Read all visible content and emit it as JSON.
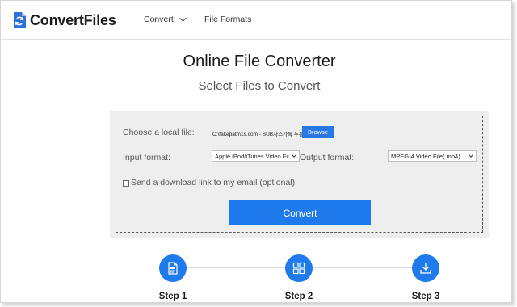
{
  "header": {
    "logo_text": "ConvertFiles",
    "nav": [
      {
        "label": "Convert",
        "has_dropdown": true
      },
      {
        "label": "File Formats",
        "has_dropdown": false
      }
    ]
  },
  "main": {
    "title": "Online File Converter",
    "subtitle": "Select Files to Convert"
  },
  "form": {
    "local_file_label": "Choose a local file:",
    "file_value": "C:\\fakepath\\1s.com - SUB자즈가톡 두통",
    "browse_label": "Browse",
    "input_format_label": "Input format:",
    "input_format_value": "Apple iPod/iTunes Video Fil",
    "output_format_label": "Output format:",
    "output_format_value": "MPEG-4 Video File(.mp4)",
    "email_checkbox_label": "Send a download link to my email (optional):",
    "email_checked": false,
    "convert_label": "Convert"
  },
  "steps": [
    {
      "label": "Step 1",
      "icon": "document-upload-icon"
    },
    {
      "label": "Step 2",
      "icon": "grid-icon"
    },
    {
      "label": "Step 3",
      "icon": "download-icon"
    }
  ],
  "colors": {
    "accent": "#1f7aeb",
    "panel_bg": "#eeeeee",
    "logo_icon": "#2f6fdc"
  }
}
